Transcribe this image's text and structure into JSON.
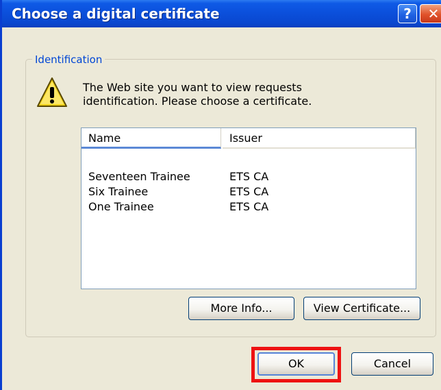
{
  "window": {
    "title": "Choose a digital certificate",
    "help_glyph": "?",
    "close_glyph": "✕"
  },
  "group": {
    "label": "Identification"
  },
  "message": "The Web site you want to view requests identification. Please choose a certificate.",
  "icon": "warning-icon",
  "list": {
    "columns": [
      "Name",
      "Issuer"
    ],
    "rows": [
      {
        "name": "Seventeen Trainee",
        "issuer": "ETS CA"
      },
      {
        "name": "Six Trainee",
        "issuer": "ETS CA"
      },
      {
        "name": "One Trainee",
        "issuer": "ETS CA"
      }
    ]
  },
  "buttons": {
    "more_info": "More Info...",
    "view_certificate": "View Certificate...",
    "ok": "OK",
    "cancel": "Cancel"
  },
  "colors": {
    "titlebar": "#0b50dc",
    "group_label": "#0046d5",
    "highlight": "#ee1212"
  }
}
